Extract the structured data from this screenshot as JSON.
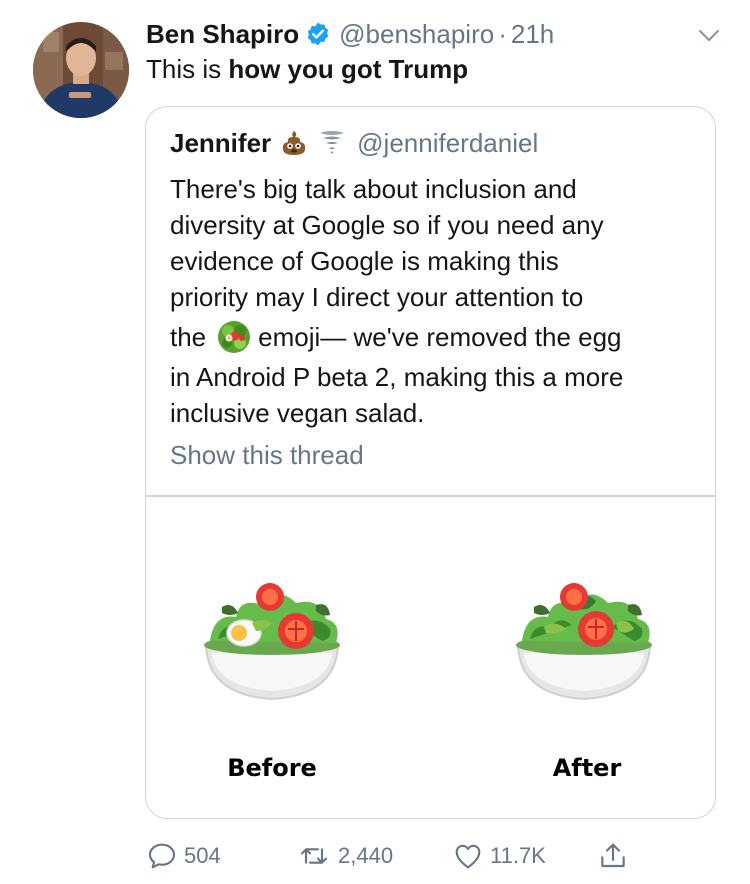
{
  "tweet": {
    "author_name": "Ben Shapiro",
    "handle": "@benshapiro",
    "separator": "·",
    "time": "21h",
    "text_plain": "This is ",
    "text_bold": "how you got Trump"
  },
  "quote": {
    "author_name": "Jennifer",
    "handle": "@jenniferdaniel",
    "author_emojis": [
      "pile-of-poo-icon",
      "tornado-icon"
    ],
    "body_lines": [
      "There's big talk about inclusion and",
      "diversity at Google so if you need any",
      "evidence of Google is making this",
      "priority may I direct your attention to"
    ],
    "line5_before": "the",
    "line5_after": "emoji— we've removed the egg",
    "line6": "in Android P beta 2, making this a more",
    "line7": "inclusive vegan salad.",
    "show_thread": "Show this thread",
    "image": {
      "before_label": "Before",
      "after_label": "After"
    }
  },
  "actions": {
    "replies": "504",
    "retweets": "2,440",
    "likes": "11.7K"
  },
  "colors": {
    "verified": "#1da1f2",
    "muted": "#657786",
    "border": "#ccd6dd"
  }
}
